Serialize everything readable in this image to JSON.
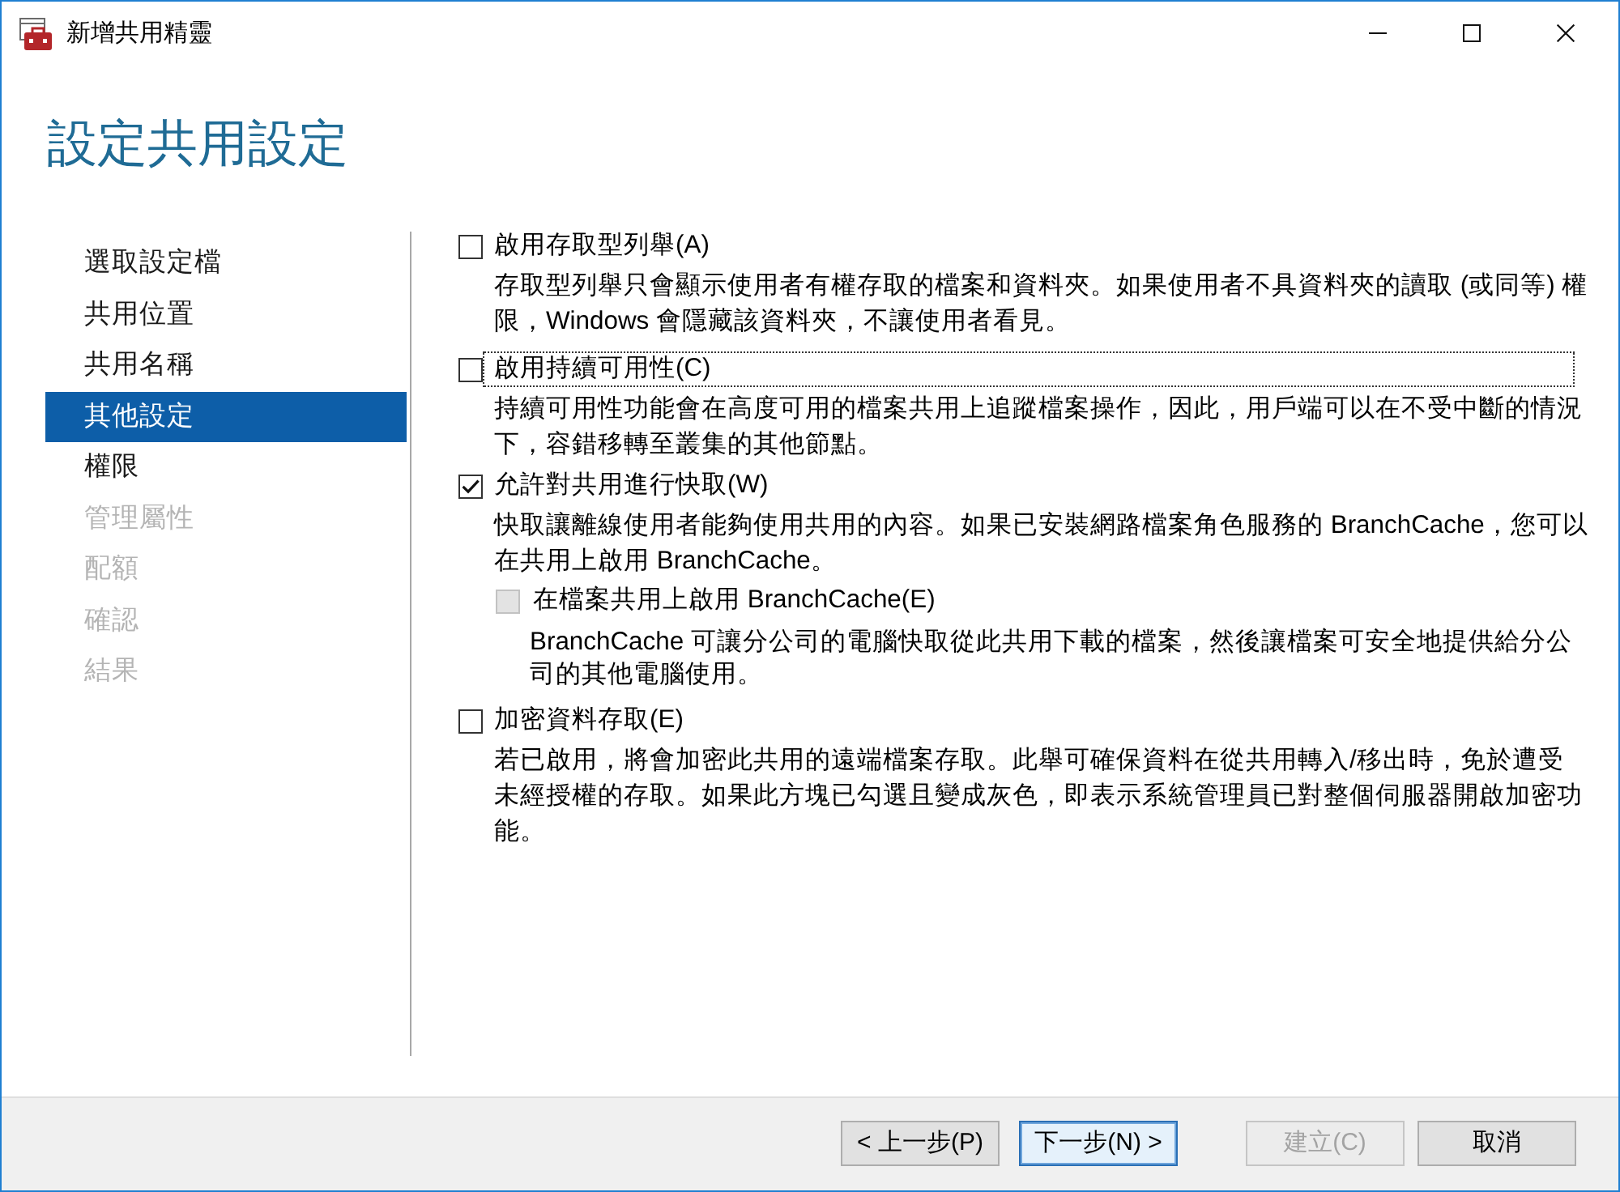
{
  "window": {
    "title": "新增共用精靈"
  },
  "page_title": "設定共用設定",
  "steps": [
    {
      "label": "選取設定檔",
      "selected": false,
      "disabled": false
    },
    {
      "label": "共用位置",
      "selected": false,
      "disabled": false
    },
    {
      "label": "共用名稱",
      "selected": false,
      "disabled": false
    },
    {
      "label": "其他設定",
      "selected": true,
      "disabled": false
    },
    {
      "label": "權限",
      "selected": false,
      "disabled": false
    },
    {
      "label": "管理屬性",
      "selected": false,
      "disabled": true
    },
    {
      "label": "配額",
      "selected": false,
      "disabled": true
    },
    {
      "label": "確認",
      "selected": false,
      "disabled": true
    },
    {
      "label": "結果",
      "selected": false,
      "disabled": true
    }
  ],
  "options": [
    {
      "label": "啟用存取型列舉(A)",
      "checked": false,
      "disabled": false,
      "focused": false,
      "description": "存取型列舉只會顯示使用者有權存取的檔案和資料夾。如果使用者不具資料夾的讀取 (或同等) 權限，Windows 會隱藏該資料夾，不讓使用者看見。"
    },
    {
      "label": "啟用持續可用性(C)",
      "checked": false,
      "disabled": false,
      "focused": true,
      "description": "持續可用性功能會在高度可用的檔案共用上追蹤檔案操作，因此，用戶端可以在不受中斷的情況下，容錯移轉至叢集的其他節點。"
    },
    {
      "label": "允許對共用進行快取(W)",
      "checked": true,
      "disabled": false,
      "focused": false,
      "description": "快取讓離線使用者能夠使用共用的內容。如果已安裝網路檔案角色服務的 BranchCache，您可以在共用上啟用 BranchCache。",
      "children": [
        {
          "label": "在檔案共用上啟用 BranchCache(E)",
          "checked": false,
          "disabled": true,
          "focused": false,
          "description": "BranchCache 可讓分公司的電腦快取從此共用下載的檔案，然後讓檔案可安全地提供給分公司的其他電腦使用。"
        }
      ]
    },
    {
      "label": "加密資料存取(E)",
      "checked": false,
      "disabled": false,
      "focused": false,
      "description": "若已啟用，將會加密此共用的遠端檔案存取。此舉可確保資料在從共用轉入/移出時，免於遭受未經授權的存取。如果此方塊已勾選且變成灰色，即表示系統管理員已對整個伺服器開啟加密功能。"
    }
  ],
  "buttons": [
    {
      "label": "< 上一步(P)",
      "default": false,
      "disabled": false
    },
    {
      "label": "下一步(N) >",
      "default": true,
      "disabled": false
    },
    {
      "label": "建立(C)",
      "default": false,
      "disabled": true
    },
    {
      "label": "取消",
      "default": false,
      "disabled": false
    }
  ]
}
